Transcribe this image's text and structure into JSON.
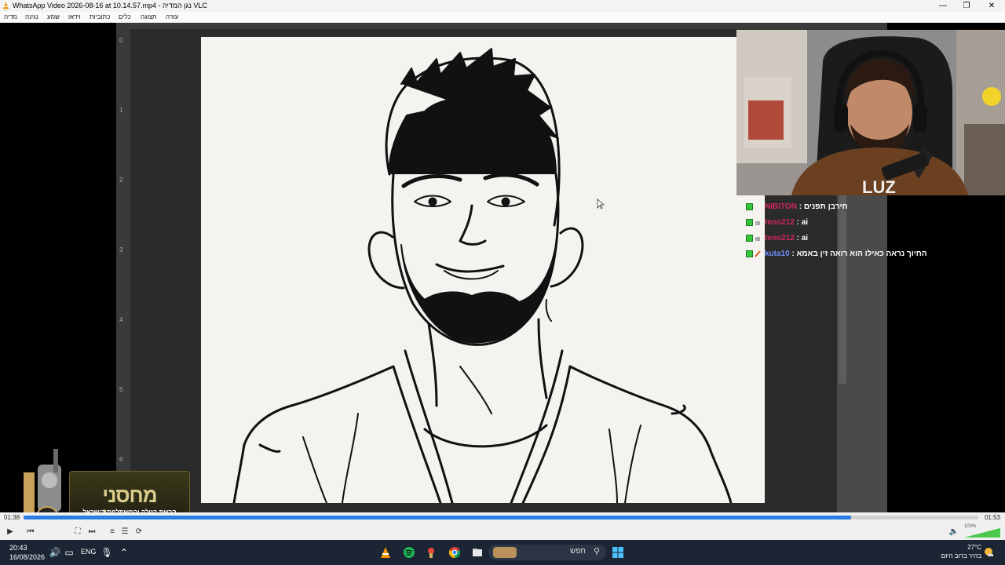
{
  "window": {
    "title": "WhatsApp Video 2026-08-16 at 10.14.57.mp4 - נגן המדיה VLC",
    "minimize": "—",
    "restore": "❐",
    "close": "✕"
  },
  "menu": {
    "items": [
      "מדיה",
      "נגינה",
      "שמע",
      "וידאו",
      "כתוביות",
      "כלים",
      "תצוגה",
      "עזרה"
    ]
  },
  "ruler": {
    "ticks": [
      "0",
      "1",
      "2",
      "3",
      "4",
      "5",
      "6"
    ]
  },
  "chat": {
    "lines": [
      {
        "user": "NIBITON",
        "user_color": "#d3265b",
        "sep": " : ",
        "text": "חירבן תפנים"
      },
      {
        "user": "teoo212",
        "user_color": "#d3265b",
        "sep": " : ",
        "text": "ai"
      },
      {
        "user": "teoo212",
        "user_color": "#d3265b",
        "sep": " : ",
        "text": "ai"
      },
      {
        "user": "kuta10",
        "user_color": "#6c8df5",
        "sep": " : ",
        "text": "החיוך נראה כאילו הוא רואה זין באמא"
      }
    ]
  },
  "webcam": {
    "shirt_text": "LUZ"
  },
  "overlay_logo": {
    "title": "מחסני חשמל",
    "subtitle": "הרשת הזולה והמשתלמת בישראל"
  },
  "player": {
    "elapsed": "01:38",
    "total": "01:53",
    "progress": 0.867,
    "volume_label": "100%",
    "volume": 1.0,
    "accent": "#2a7de1"
  },
  "taskbar": {
    "time": "20:43",
    "date": "16/08/2026",
    "lang": "ENG",
    "search_placeholder": "חפש",
    "temp": "27°C",
    "weather_text": "בהיר ברוב היום",
    "bg": "#1c2533"
  }
}
